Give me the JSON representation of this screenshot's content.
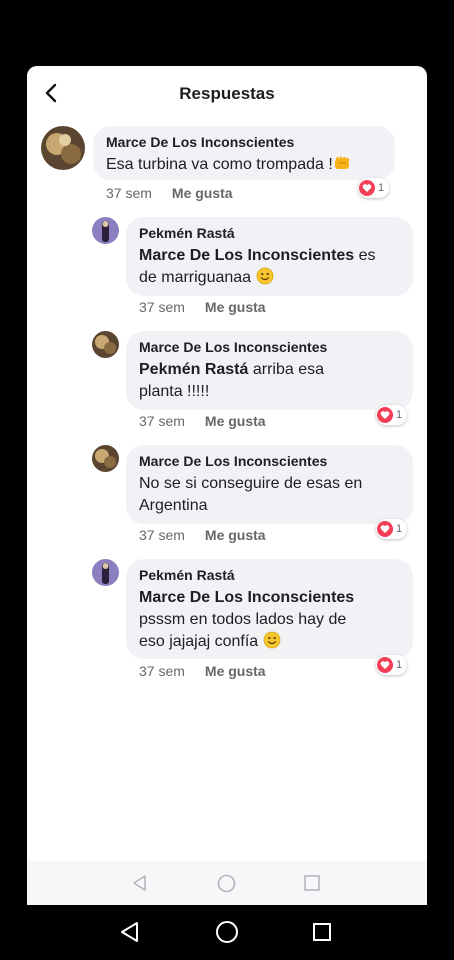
{
  "header": {
    "title": "Respuestas"
  },
  "comments": [
    {
      "author": "Marce De Los Inconscientes",
      "mention": "",
      "text": "Esa turbina va como trompada !",
      "trailing_emoji": "fist",
      "time": "37 sem",
      "like_label": "Me gusta",
      "reaction_count": "1"
    },
    {
      "author": "Pekmén Rastá",
      "mention": "Marce De Los Inconscientes",
      "text_line1": " es",
      "text_line2": "de marriguanaa ",
      "trailing_emoji": "smile",
      "time": "37 sem",
      "like_label": "Me gusta",
      "reaction_count": ""
    },
    {
      "author": "Marce De Los Inconscientes",
      "mention": "Pekmén Rastá",
      "text_line1": " arriba esa",
      "text_line2": "planta !!!!!",
      "time": "37 sem",
      "like_label": "Me gusta",
      "reaction_count": "1"
    },
    {
      "author": "Marce De Los Inconscientes",
      "mention": "",
      "text_line1": "No se si conseguire de esas en",
      "text_line2": "Argentina",
      "time": "37 sem",
      "like_label": "Me gusta",
      "reaction_count": "1"
    },
    {
      "author": "Pekmén Rastá",
      "mention": "Marce De Los Inconscientes",
      "text_line1": "psssm en todos lados hay de",
      "text_line2": "eso jajajaj confía ",
      "trailing_emoji": "smile",
      "time": "37 sem",
      "like_label": "Me gusta",
      "reaction_count": "1"
    }
  ],
  "colors": {
    "reaction_heart": "#f33e58",
    "bubble": "#f0f2f5",
    "meta_text": "#65676b"
  }
}
